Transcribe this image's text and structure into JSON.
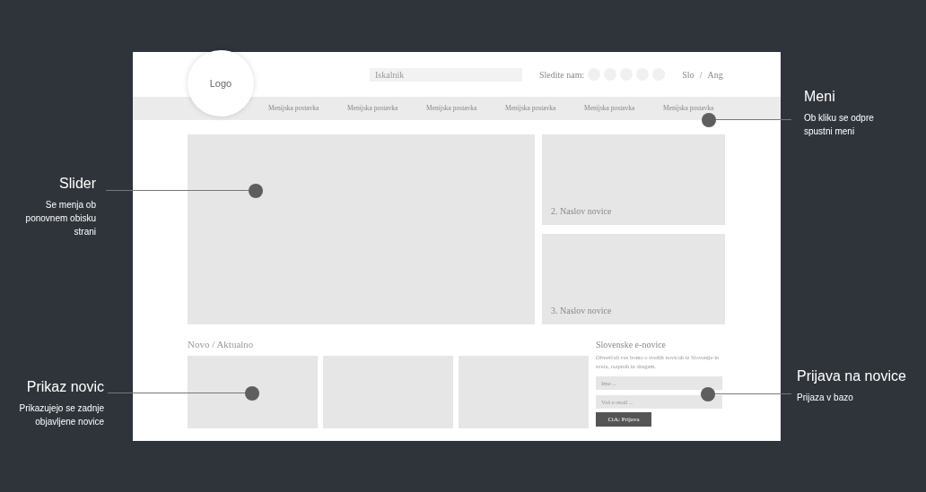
{
  "header": {
    "logo": "Logo",
    "search": {
      "placeholder": "Iskalnik"
    },
    "follow_label": "Sledite nam:",
    "languages": [
      "Slo",
      "Ang"
    ],
    "language_separator": "/"
  },
  "menu": [
    "Menijska postavka",
    "Menijska postavka",
    "Menijska postavka",
    "Menijska postavka",
    "Menijska postavka",
    "Menijska postavka"
  ],
  "side_news": [
    "2. Naslov novice",
    "3. Naslov novice"
  ],
  "news": {
    "title": "Novo / Aktualno"
  },
  "newsletter": {
    "title": "Slovenske e-novice",
    "description": "Obveščali vas bomo o svežih novicah iz Slovenije in sveta, razpisih in drugem.",
    "fields": [
      {
        "placeholder": "Ime .."
      },
      {
        "placeholder": "Vaš e-mail .."
      }
    ],
    "button": "CtA: Prijava"
  },
  "annotations": [
    {
      "kind": "right",
      "title": "Meni",
      "lines": [
        "Ob kliku se odpre",
        "spustni meni"
      ]
    },
    {
      "kind": "left",
      "title": "Slider",
      "lines": [
        "Se menja ob",
        "ponovnem obisku",
        "strani"
      ]
    },
    {
      "kind": "left",
      "title": "Prikaz novic",
      "lines": [
        "Prikazujejo se zadnje",
        "objavljene novice"
      ]
    },
    {
      "kind": "right",
      "title": "Prijava na novice",
      "lines": [
        "Prijaza v bazo"
      ]
    }
  ]
}
